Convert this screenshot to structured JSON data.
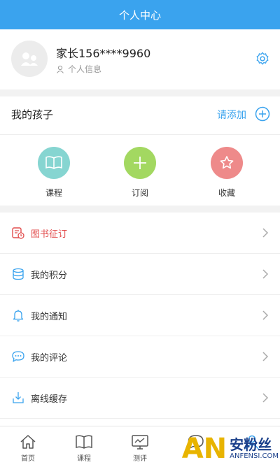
{
  "header": {
    "title": "个人中心"
  },
  "profile": {
    "username": "家长156****9960",
    "subinfo": "个人信息"
  },
  "kids": {
    "title": "我的孩子",
    "add_label": "请添加"
  },
  "quick": [
    {
      "label": "课程",
      "icon": "book-icon",
      "color": "#86d5d1"
    },
    {
      "label": "订阅",
      "icon": "plus-icon",
      "color": "#a3d861"
    },
    {
      "label": "收藏",
      "icon": "star-icon",
      "color": "#ee8a8a"
    }
  ],
  "menu": [
    {
      "label": "图书征订",
      "icon": "book-order-icon",
      "color": "#e24d4d"
    },
    {
      "label": "我的积分",
      "icon": "points-icon",
      "color": "#3aa3ee"
    },
    {
      "label": "我的通知",
      "icon": "bell-icon",
      "color": "#3aa3ee"
    },
    {
      "label": "我的评论",
      "icon": "comment-icon",
      "color": "#3aa3ee"
    },
    {
      "label": "离线缓存",
      "icon": "download-icon",
      "color": "#3aa3ee"
    },
    {
      "label": "",
      "icon": "more-icon",
      "color": "#3aa3ee"
    }
  ],
  "tabs": [
    {
      "label": "首页",
      "icon": "home-icon"
    },
    {
      "label": "课程",
      "icon": "book-icon"
    },
    {
      "label": "测评",
      "icon": "monitor-icon"
    },
    {
      "label": "",
      "icon": "chat-icon"
    },
    {
      "label": "",
      "icon": "user-icon"
    }
  ],
  "watermark": {
    "big": "AN",
    "cn": "安粉丝",
    "en": "ANFENSI.COM"
  },
  "colors": {
    "accent": "#3aa3ee",
    "header": "#3aa3ee"
  }
}
